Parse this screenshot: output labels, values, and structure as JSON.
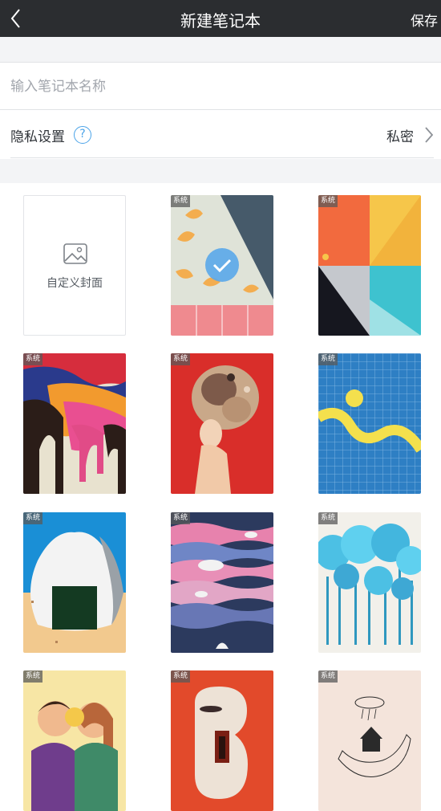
{
  "header": {
    "title": "新建笔记本",
    "save_label": "保存",
    "back_icon": "chevron-left-icon"
  },
  "name_field": {
    "value": "",
    "placeholder": "输入笔记本名称"
  },
  "privacy": {
    "label": "隐私设置",
    "help_icon": "question-mark",
    "value": "私密"
  },
  "covers": {
    "custom_label": "自定义封面",
    "system_badge": "系统",
    "selected_index": 1,
    "items": [
      {
        "type": "custom"
      },
      {
        "type": "system",
        "theme": "leaves-and-stripes"
      },
      {
        "type": "system",
        "theme": "geometric-blocks"
      },
      {
        "type": "system",
        "theme": "melting-rainbow"
      },
      {
        "type": "system",
        "theme": "girl-with-ornate-hair"
      },
      {
        "type": "system",
        "theme": "blue-grid-wave"
      },
      {
        "type": "system",
        "theme": "rice-ball"
      },
      {
        "type": "system",
        "theme": "whales-and-waves"
      },
      {
        "type": "system",
        "theme": "blue-trees"
      },
      {
        "type": "system",
        "theme": "hugging-couple"
      },
      {
        "type": "system",
        "theme": "red-abstract-door"
      },
      {
        "type": "system",
        "theme": "house-in-hand"
      }
    ]
  },
  "colors": {
    "header_bg": "#2b2d30",
    "accent": "#4aa3e8",
    "page_bg": "#f3f4f6"
  }
}
